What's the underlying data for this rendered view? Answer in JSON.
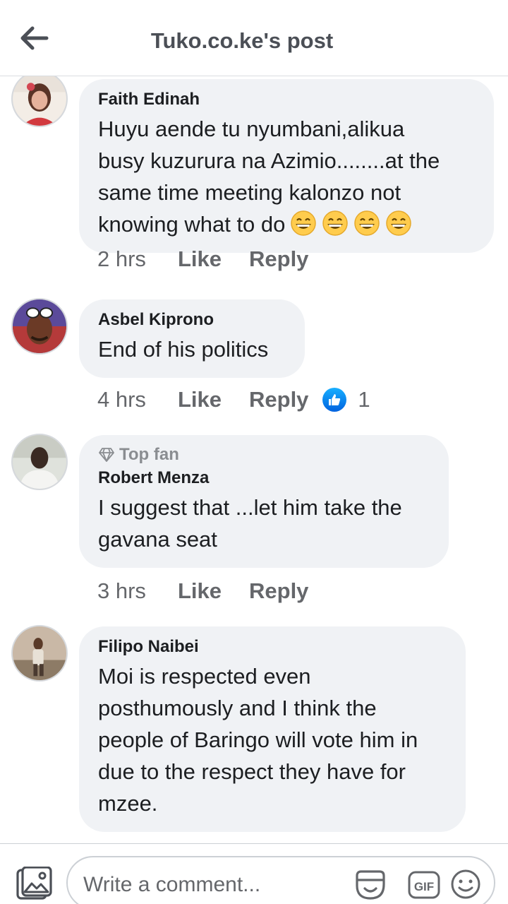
{
  "header": {
    "title": "Tuko.co.ke's post"
  },
  "comments": [
    {
      "name": "Faith Edinah",
      "lines": [
        "Huyu aende tu nyumbani,alikua",
        "busy kuzurura  na Azimio........at the",
        "same time meeting kalonzo not",
        "knowing what to do"
      ],
      "emoji_count": 4,
      "time": "2 hrs",
      "like": "Like",
      "reply": "Reply"
    },
    {
      "name": "Asbel Kiprono",
      "lines": [
        "End of his politics"
      ],
      "time": "4 hrs",
      "like": "Like",
      "reply": "Reply",
      "reactions": "1"
    },
    {
      "badge": "Top fan",
      "name": "Robert Menza",
      "lines": [
        "I suggest that ...let him take the",
        "gavana seat"
      ],
      "time": "3 hrs",
      "like": "Like",
      "reply": "Reply"
    },
    {
      "name": "Filipo Naibei",
      "lines": [
        "Moi is respected even",
        "posthumously and I think the",
        "people of Baringo will vote him in",
        "due  to the respect they have for",
        "mzee."
      ]
    }
  ],
  "composer": {
    "placeholder": "Write a comment..."
  },
  "colors": {
    "bubble": "#f0f2f5",
    "like_blue": "#1877f2",
    "secondary_text": "#65676b"
  }
}
